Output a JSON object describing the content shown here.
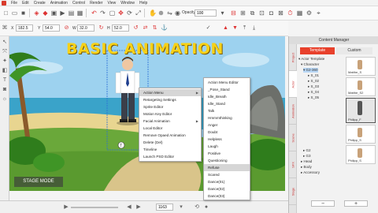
{
  "menubar": {
    "items": [
      "File",
      "Edit",
      "Create",
      "Animation",
      "Control",
      "Render",
      "View",
      "Window",
      "Help"
    ]
  },
  "toolbar": {
    "opacity_label": "Opacity",
    "opacity_value": "100"
  },
  "propbar": {
    "x_label": "X",
    "x_value": "182.5",
    "y_label": "Y",
    "y_value": "54.0",
    "w_label": "W",
    "w_value": "32.0",
    "h_label": "H",
    "h_value": "52.0"
  },
  "stage": {
    "title": "BASIC ANIMATION",
    "mode_label": "STAGE MODE",
    "colors": {
      "sky": "#9dd2ef",
      "grass": "#6aa83a",
      "title": "#f7d117"
    }
  },
  "context_menu": {
    "items": [
      {
        "label": "Action Menu",
        "has_sub": true
      },
      {
        "label": "Retargeting Settings",
        "has_sub": false
      },
      {
        "label": "Sprite Editor",
        "has_sub": false
      },
      {
        "label": "Motion Key Editor",
        "has_sub": false
      },
      {
        "label": "Facial Animation",
        "has_sub": true
      },
      {
        "label": "Local Editor",
        "has_sub": false
      },
      {
        "label": "Remove Opaed Animation",
        "has_sub": false
      },
      {
        "label": "Delete (Del)",
        "has_sub": false
      },
      {
        "label": "Timeline",
        "has_sub": false
      },
      {
        "label": "Launch PSD Editor",
        "has_sub": false
      }
    ]
  },
  "action_submenu": {
    "items": [
      "Action Menu Editor",
      "_Pose_Stand",
      "Idle_Breath",
      "Idle_Stand",
      "Talk",
      "Hmmmthinking",
      "Anger",
      "Doubt",
      "Helpless",
      "Laugh",
      "Positive",
      "Questioning",
      "Refuse",
      "Scared",
      "Dance(01)",
      "Dance(02)",
      "Dance(03)"
    ],
    "highlighted": "Refuse"
  },
  "panel": {
    "title": "Content Manager",
    "side_tabs": [
      "Project",
      "Actor",
      "Animation",
      "Scene",
      "SFX",
      "Stage"
    ],
    "tab_template": "Template",
    "tab_custom": "Custom",
    "tree": [
      {
        "label": "Actor Template",
        "indent": 0
      },
      {
        "label": "Character",
        "indent": 1
      },
      {
        "label": "G2-360",
        "indent": 2,
        "selected": true
      },
      {
        "label": "S_01",
        "indent": 3
      },
      {
        "label": "S_02",
        "indent": 3
      },
      {
        "label": "S_03",
        "indent": 3
      },
      {
        "label": "S_04",
        "indent": 3
      },
      {
        "label": "S_05",
        "indent": 3
      },
      {
        "label": "G2",
        "indent": 2
      },
      {
        "label": "G3",
        "indent": 2
      },
      {
        "label": "Head",
        "indent": 1
      },
      {
        "label": "Body",
        "indent": 1
      },
      {
        "label": "Accessory",
        "indent": 1
      }
    ],
    "thumbs": [
      "Matthe_S",
      "Matthe_S2",
      "Philipp_F",
      "Philipp_S",
      "Philipp_S"
    ],
    "add_label": "+",
    "remove_label": "−"
  },
  "bottombar": {
    "frame_value": "1163"
  }
}
